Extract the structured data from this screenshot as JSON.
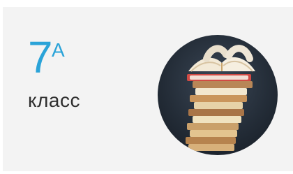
{
  "card": {
    "grade_number": "7",
    "grade_letter": "А",
    "label": "класс"
  },
  "icons": {
    "avatar": "stack-of-books-icon"
  },
  "colors": {
    "accent": "#2aa3d8",
    "card_bg": "#f3f3f3",
    "label": "#2f2f2f"
  }
}
